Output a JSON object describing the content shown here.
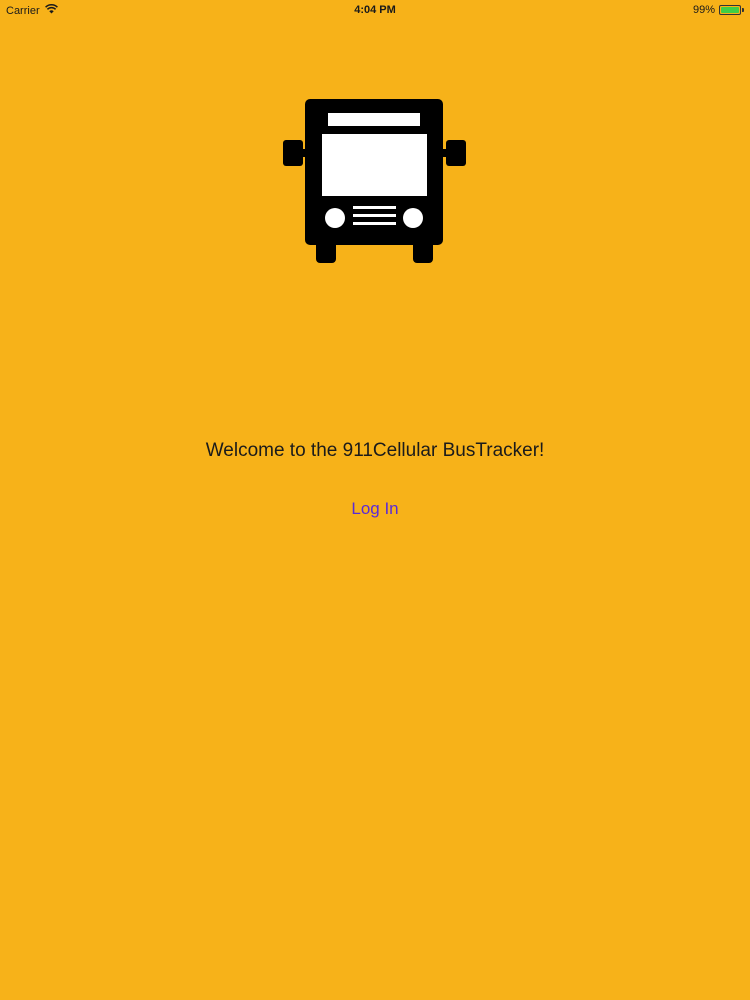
{
  "status_bar": {
    "carrier": "Carrier",
    "time": "4:04 PM",
    "battery_text": "99%",
    "battery_level": 0.99,
    "wifi_icon": "wifi-icon"
  },
  "logo": {
    "icon": "bus-icon"
  },
  "main": {
    "welcome_text": "Welcome to the 911Cellular BusTracker!",
    "login_label": "Log In"
  },
  "colors": {
    "background": "#F7B219",
    "link": "#5b2bd6",
    "battery_green": "#3fcf44"
  }
}
